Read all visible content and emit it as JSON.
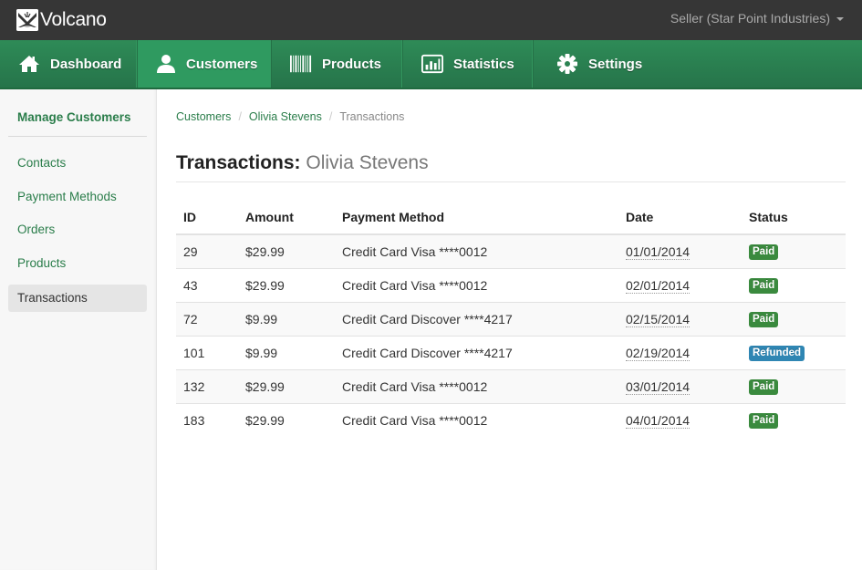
{
  "app": {
    "name": "Volcano",
    "user_menu": "Seller (Star Point Industries)"
  },
  "nav": {
    "items": [
      {
        "label": "Dashboard",
        "icon": "home-icon",
        "active": false
      },
      {
        "label": "Customers",
        "icon": "user-icon",
        "active": true
      },
      {
        "label": "Products",
        "icon": "barcode-icon",
        "active": false
      },
      {
        "label": "Statistics",
        "icon": "bar-chart-icon",
        "active": false
      },
      {
        "label": "Settings",
        "icon": "gear-icon",
        "active": false
      }
    ]
  },
  "sidebar": {
    "title": "Manage Customers",
    "items": [
      {
        "label": "Contacts",
        "active": false
      },
      {
        "label": "Payment Methods",
        "active": false
      },
      {
        "label": "Orders",
        "active": false
      },
      {
        "label": "Products",
        "active": false
      },
      {
        "label": "Transactions",
        "active": true
      }
    ]
  },
  "breadcrumb": {
    "items": [
      "Customers",
      "Olivia Stevens"
    ],
    "separator": "/",
    "current": "Transactions"
  },
  "page": {
    "title": "Transactions:",
    "subtitle": "Olivia Stevens"
  },
  "table": {
    "columns": [
      "ID",
      "Amount",
      "Payment Method",
      "Date",
      "Status"
    ],
    "rows": [
      {
        "id": "29",
        "amount": "$29.99",
        "method": "Credit Card Visa ****0012",
        "date": "01/01/2014",
        "status": "Paid"
      },
      {
        "id": "43",
        "amount": "$29.99",
        "method": "Credit Card Visa ****0012",
        "date": "02/01/2014",
        "status": "Paid"
      },
      {
        "id": "72",
        "amount": "$9.99",
        "method": "Credit Card Discover ****4217",
        "date": "02/15/2014",
        "status": "Paid"
      },
      {
        "id": "101",
        "amount": "$9.99",
        "method": "Credit Card Discover ****4217",
        "date": "02/19/2014",
        "status": "Refunded"
      },
      {
        "id": "132",
        "amount": "$29.99",
        "method": "Credit Card Visa ****0012",
        "date": "03/01/2014",
        "status": "Paid"
      },
      {
        "id": "183",
        "amount": "$29.99",
        "method": "Credit Card Visa ****0012",
        "date": "04/01/2014",
        "status": "Paid"
      }
    ]
  },
  "colors": {
    "topbar": "#363636",
    "nav_green": "#2e8b57",
    "nav_active": "#2f9a60",
    "link_green": "#2a7d4a",
    "badge_paid": "#3a8a3e",
    "badge_refunded": "#2f86b3"
  }
}
